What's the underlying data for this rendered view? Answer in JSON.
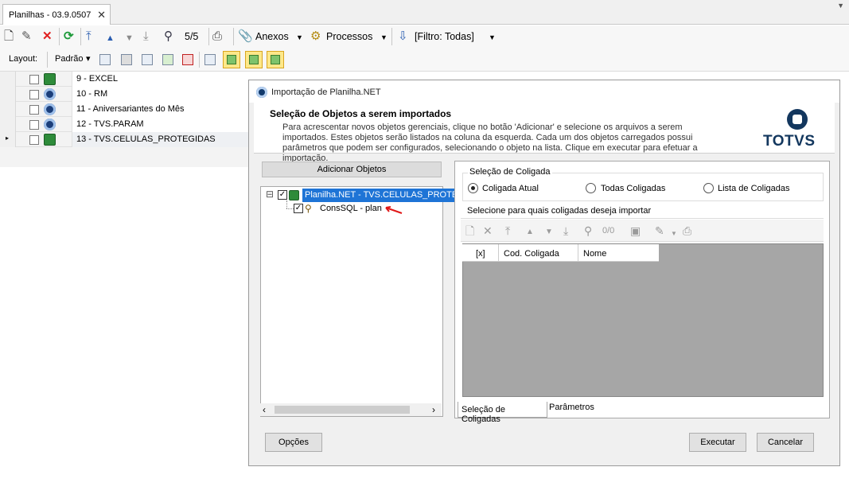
{
  "window": {
    "tab_title": "Planilhas - 03.9.0507",
    "tab_close": "✕",
    "overflow": "▼"
  },
  "toolbar": {
    "counter": "5/5",
    "anexos": "Anexos",
    "processos": "Processos",
    "filtro": "[Filtro: Todas]",
    "dropdown": "▼"
  },
  "layout_bar": {
    "label": "Layout:",
    "padrao": "Padrão",
    "padrao_arrow": "▾"
  },
  "grid": {
    "rows": [
      {
        "label": "9 - EXCEL",
        "icon": "excel-sheet-icon"
      },
      {
        "label": "10 - RM",
        "icon": "totvs-globe-icon"
      },
      {
        "label": "11 - Aniversariantes do Mês",
        "icon": "totvs-globe-icon"
      },
      {
        "label": "12 - TVS.PARAM",
        "icon": "totvs-globe-icon"
      },
      {
        "label": "13 - TVS.CELULAS_PROTEGIDAS",
        "icon": "excel-sheet-icon",
        "current": true
      }
    ]
  },
  "dialog": {
    "title": "Importação de Planilha.NET",
    "header_title": "Seleção de Objetos a serem importados",
    "header_desc": "Para acrescentar novos objetos gerenciais, clique no botão 'Adicionar' e selecione os arquivos a serem importados. Estes objetos serão listados na coluna da esquerda. Cada um dos objetos carregados possui parâmetros que podem ser configurados, selecionando o objeto na lista. Clique em executar para efetuar a importação.",
    "logo_text": "TOTVS",
    "add_button": "Adicionar Objetos",
    "tree": {
      "expander": "⊟",
      "root": "Planilha.NET - TVS.CELULAS_PROTEGIDAS",
      "child": "ConsSQL - plan",
      "check": "✓"
    },
    "scroll": {
      "left": "‹",
      "right": "›"
    },
    "coligada": {
      "legend": "Seleção de Coligada",
      "options": [
        "Coligada Atual",
        "Todas Coligadas",
        "Lista de Coligadas"
      ],
      "selected": 0,
      "select_label": "Selecione para quais coligadas deseja importar",
      "counter": "0/0",
      "columns": [
        "[x]",
        "Cod. Coligada",
        "Nome"
      ]
    },
    "tabs": [
      "Seleção de Coligadas",
      "Parâmetros"
    ],
    "buttons": {
      "opcoes": "Opções",
      "executar": "Executar",
      "cancelar": "Cancelar"
    }
  }
}
